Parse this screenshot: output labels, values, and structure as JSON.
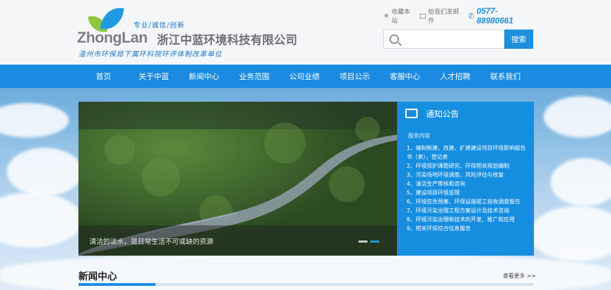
{
  "header": {
    "brand_en": "ZhongLan",
    "brand_cn": "浙江中蓝环境科技有限公司",
    "slogan": "专业/诚信/创新",
    "sub_slogan": "温州市环保局下属环科院环评体制改革单位",
    "top_links": [
      {
        "icon": "star-icon",
        "label": "收藏本站"
      },
      {
        "icon": "mail-icon",
        "label": "给我们发邮件"
      }
    ],
    "phone": "0577-88980661",
    "search": {
      "placeholder": "",
      "button_label": "搜索"
    }
  },
  "nav": {
    "items": [
      "首页",
      "关于中蓝",
      "新闻中心",
      "业务范围",
      "公司业绩",
      "项目公示",
      "客服中心",
      "人才招聘",
      "联系我们"
    ]
  },
  "banner": {
    "caption": "清洁的淡水，是日常生活不可或缺的资源",
    "slide_count": 2,
    "active_slide": 2
  },
  "notice": {
    "title": "通知公告",
    "subtitle": "服务内容",
    "items": [
      "1、编制新建、改建、扩建建设项目环境影响报告书（表），登记表",
      "2、环境保护课题研究、环保相关规划编制",
      "3、污染场地环境调查、风险评估与修复",
      "4、清洁生产审核和咨询",
      "5、建设项目环境监理",
      "6、环境应急预案、环保设施竣工验收调查报告",
      "7、环境污染治理工程方案设计及技术咨询",
      "8、环境污染治理新技术的开发、推广和应用",
      "9、相关环保综合信息服务"
    ]
  },
  "news": {
    "title": "新闻中心",
    "more": "查看更多 >>"
  },
  "colors": {
    "primary": "#1a8be0",
    "notice_bg": "#168ee0",
    "leaf_green": "#8cc63f"
  }
}
